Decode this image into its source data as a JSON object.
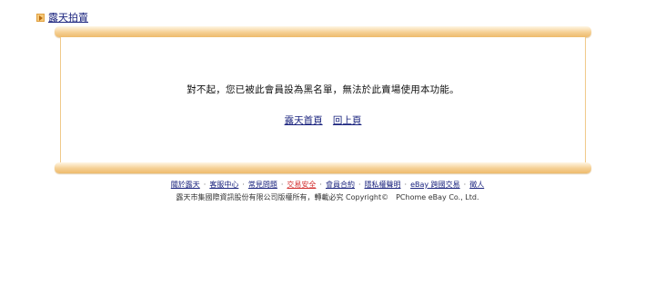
{
  "topnav": {
    "site_link": "露天拍賣"
  },
  "panel": {
    "message": "對不起，您已被此會員設為黑名單，無法於此賣場使用本功能。",
    "home_link": "露天首頁",
    "back_link": "回上頁"
  },
  "footer": {
    "links": [
      "關於露天",
      "客服中心",
      "常見問題",
      "交易安全",
      "會員合約",
      "隱私權聲明",
      "eBay 跨國交易",
      "徵人"
    ],
    "separator": "·",
    "copyright": "露天市集國際資訊股份有限公司版權所有，轉載必究 Copyright©　PChome eBay Co., Ltd."
  },
  "colors": {
    "link": "#1a237e",
    "highlight_link": "#d32f2f",
    "panel_border": "#f0c98a"
  }
}
